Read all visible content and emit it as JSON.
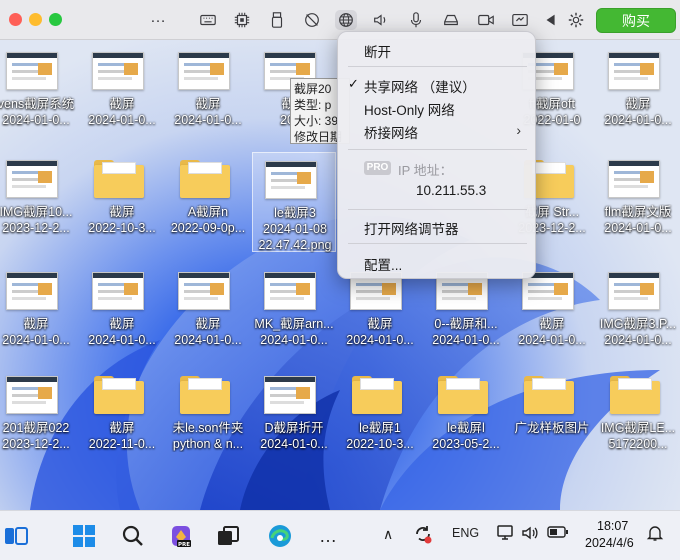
{
  "toolbar": {
    "more_label": "…",
    "buy_label": "购买",
    "icons": [
      "keyboard-icon",
      "cpu-icon",
      "usb-icon",
      "camera-off-icon",
      "network-globe-icon",
      "speaker-icon",
      "microphone-icon",
      "disk-icon",
      "video-camera-icon",
      "screen-share-icon",
      "play-left-icon",
      "gear-icon"
    ]
  },
  "desktop": {
    "icons": [
      {
        "label": "vens截屏系统",
        "sub": "2024-01-0...",
        "kind": "thumb"
      },
      {
        "label": "截屏",
        "sub": "2024-01-0...",
        "kind": "thumb"
      },
      {
        "label": "截屏",
        "sub": "2024-01-0...",
        "kind": "thumb"
      },
      {
        "label": "截屏",
        "sub": "2024",
        "kind": "thumb"
      },
      {
        "label": "",
        "sub": "",
        "kind": "none"
      },
      {
        "label": "",
        "sub": "",
        "kind": "none"
      },
      {
        "label": "ft截屏oft",
        "sub": "2022-01-0",
        "kind": "thumb"
      },
      {
        "label": "截屏",
        "sub": "2024-01-0...",
        "kind": "thumb"
      },
      {
        "label": "IMG截屏10...",
        "sub": "2023-12-2...",
        "kind": "thumb"
      },
      {
        "label": "截屏",
        "sub": "2022-10-3...",
        "kind": "folder"
      },
      {
        "label": "A截屏n",
        "sub": "2022-09-0p...",
        "kind": "folder"
      },
      {
        "label": "le截屏3",
        "sub": "2024-01-08",
        "sub2": "22.47.42.png",
        "kind": "thumb"
      },
      {
        "label": "",
        "sub": "",
        "kind": "none"
      },
      {
        "label": "",
        "sub": "",
        "kind": "none"
      },
      {
        "label": "截屏 Str...",
        "sub": "2023-12-2...",
        "kind": "folder"
      },
      {
        "label": "flm截屏文版",
        "sub": "2024-01-0...",
        "kind": "thumb"
      },
      {
        "label": "截屏",
        "sub": "2024-01-0...",
        "kind": "thumb"
      },
      {
        "label": "截屏",
        "sub": "2024-01-0...",
        "kind": "thumb"
      },
      {
        "label": "截屏",
        "sub": "2024-01-0...",
        "kind": "thumb"
      },
      {
        "label": "MK_截屏arn...",
        "sub": "2024-01-0...",
        "kind": "thumb"
      },
      {
        "label": "截屏",
        "sub": "2024-01-0...",
        "kind": "thumb"
      },
      {
        "label": "0--截屏和...",
        "sub": "2024-01-0...",
        "kind": "thumb"
      },
      {
        "label": "截屏",
        "sub": "2024-01-0...",
        "kind": "thumb"
      },
      {
        "label": "IMG截屏3.P...",
        "sub": "2024-01-0...",
        "kind": "thumb"
      },
      {
        "label": "201截屏022",
        "sub": "2023-12-2...",
        "kind": "thumb"
      },
      {
        "label": "截屏",
        "sub": "2022-11-0...",
        "kind": "folder"
      },
      {
        "label": "未le.son件夹",
        "sub": "python & n...",
        "kind": "folder"
      },
      {
        "label": "D截屏折开",
        "sub": "2024-01-0...",
        "kind": "thumb"
      },
      {
        "label": "le截屏1",
        "sub": "2022-10-3...",
        "kind": "folder"
      },
      {
        "label": "le截屏l",
        "sub": "2023-05-2...",
        "kind": "folder"
      },
      {
        "label": "广龙样板图片",
        "sub": "",
        "kind": "folder"
      },
      {
        "label": "IMG截屏LE...",
        "sub": "5172200...",
        "kind": "folder"
      }
    ]
  },
  "tooltip": {
    "lines": [
      "截屏20",
      "类型: p",
      "大小: 39",
      "修改日期"
    ]
  },
  "network_menu": {
    "disconnect": "断开",
    "shared_network": "共享网络 （建议）",
    "host_only": "Host-Only 网络",
    "bridged": "桥接网络",
    "pro_badge": "PRO",
    "ip_label": "IP 地址：",
    "ip_value": "10.211.55.3",
    "open_adjuster": "打开网络调节器",
    "configure": "配置..."
  },
  "taskbar": {
    "input_method": "ENG",
    "time": "18:07",
    "date": "2024/4/6",
    "more_dots": "…",
    "chevron": "∧"
  }
}
